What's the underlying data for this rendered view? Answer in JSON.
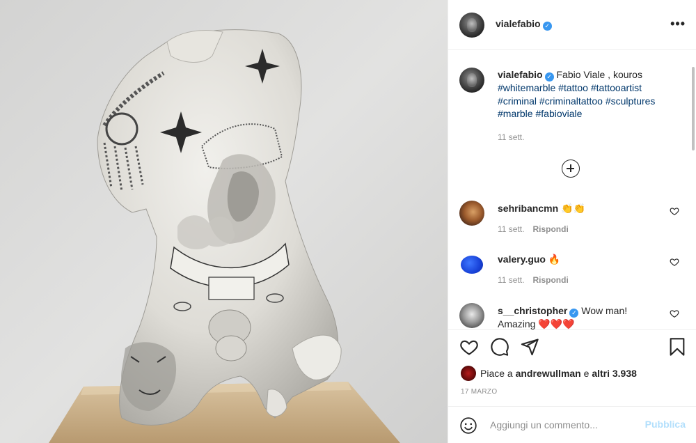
{
  "post": {
    "author": "vialefabio",
    "more_icon": "more-horizontal-icon",
    "caption": {
      "author": "vialefabio",
      "text": "Fabio Viale , kouros",
      "hashtags": [
        "#whitemarble",
        "#tattoo",
        "#tattooartist",
        "#criminal",
        "#criminaltattoo",
        "#sculptures",
        "#marble",
        "#fabioviale"
      ],
      "time": "11 sett."
    },
    "load_more_icon": "plus-circle-icon"
  },
  "comments": [
    {
      "user": "sehribancmn",
      "verified": false,
      "text": "👏👏",
      "time": "11 sett.",
      "reply": "Rispondi"
    },
    {
      "user": "valery.guo",
      "verified": false,
      "text": "🔥",
      "time": "11 sett.",
      "reply": "Rispondi"
    },
    {
      "user": "s__christopher",
      "verified": true,
      "text": "Wow man! Amazing ❤️❤️❤️",
      "time": "",
      "reply": ""
    }
  ],
  "actions": {
    "like_icon": "heart-icon",
    "comment_icon": "comment-bubble-icon",
    "share_icon": "paper-plane-icon",
    "save_icon": "bookmark-icon",
    "likes_prefix": "Piace a",
    "likes_user": "andrewullman",
    "likes_suffix": "e",
    "likes_others": "altri 3.938",
    "date": "17 MARZO"
  },
  "add_comment": {
    "emoji_icon": "emoji-smile-icon",
    "placeholder": "Aggiungi un commento...",
    "publish_label": "Pubblica"
  },
  "colors": {
    "text": "#262626",
    "secondary": "#8e8e8e",
    "hashtag": "#00376b",
    "verified": "#3897f0",
    "publish_disabled": "#b2dffc",
    "border": "#efefef"
  }
}
